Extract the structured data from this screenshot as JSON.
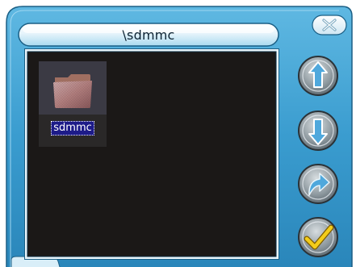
{
  "window": {
    "path": "\\sdmmc",
    "close_glyph": "✕"
  },
  "browser": {
    "items": [
      {
        "name": "sdmmc",
        "icon": "folder-icon",
        "selected": true
      }
    ]
  },
  "buttons": [
    {
      "action": "go-up",
      "icon": "up-arrow-icon"
    },
    {
      "action": "go-down",
      "icon": "down-arrow-icon"
    },
    {
      "action": "back",
      "icon": "curved-arrow-icon"
    },
    {
      "action": "confirm",
      "icon": "checkmark-icon"
    }
  ],
  "colors": {
    "frame_blue": "#3d9fd2",
    "frame_dark": "#1a6f9e",
    "pane_bg": "#1b1817",
    "selection": "#1d1b88"
  }
}
